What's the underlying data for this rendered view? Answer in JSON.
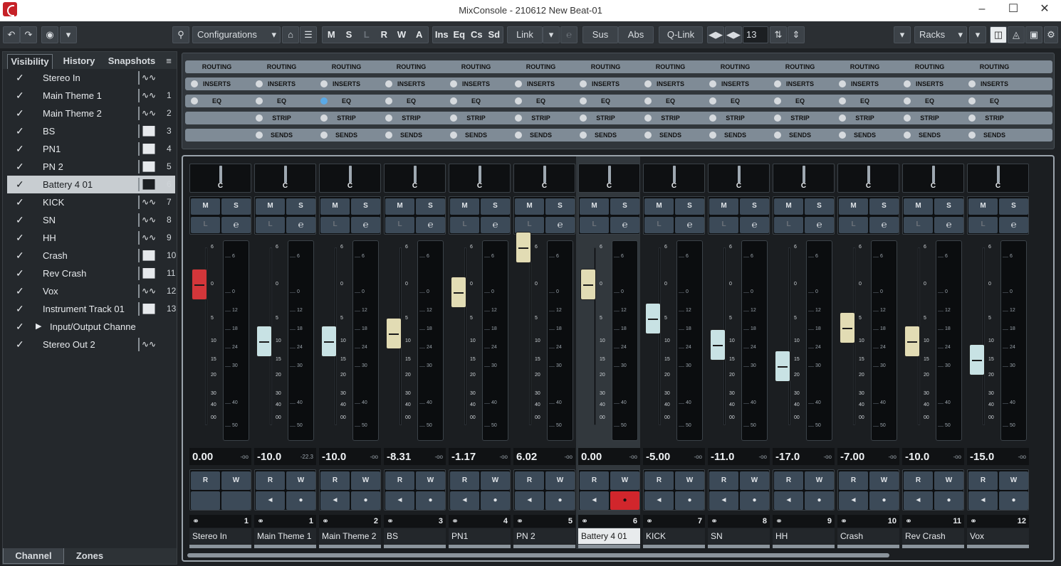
{
  "window": {
    "title": "MixConsole - 210612 New Beat-01"
  },
  "toolbar": {
    "configurations": "Configurations",
    "automation_modes": [
      "M",
      "S",
      "L",
      "R",
      "W",
      "A"
    ],
    "rack_toggles": [
      "Ins",
      "Eq",
      "Cs",
      "Sd"
    ],
    "link_label": "Link",
    "sus_label": "Sus",
    "abs_label": "Abs",
    "qlink_label": "Q-Link",
    "channel_count": "13",
    "racks_label": "Racks"
  },
  "left_panel": {
    "tabs": [
      "Visibility",
      "History",
      "Snapshots"
    ],
    "bottom_tabs": [
      "Channel",
      "Zones"
    ],
    "items": [
      {
        "name": "Stereo In",
        "icon": "waveform-icon",
        "num": ""
      },
      {
        "name": "Main Theme 1",
        "icon": "waveform-icon",
        "num": "1"
      },
      {
        "name": "Main Theme 2",
        "icon": "waveform-icon",
        "num": "2"
      },
      {
        "name": "BS",
        "icon": "piano-icon",
        "num": "3"
      },
      {
        "name": "PN1",
        "icon": "piano-icon",
        "num": "4"
      },
      {
        "name": "PN 2",
        "icon": "piano-icon",
        "num": "5"
      },
      {
        "name": "Battery 4 01",
        "icon": "piano-icon",
        "num": "6"
      },
      {
        "name": "KICK",
        "icon": "waveform-icon",
        "num": "7"
      },
      {
        "name": "SN",
        "icon": "waveform-icon",
        "num": "8"
      },
      {
        "name": "HH",
        "icon": "waveform-icon",
        "num": "9"
      },
      {
        "name": "Crash",
        "icon": "piano-icon",
        "num": "10"
      },
      {
        "name": "Rev Crash",
        "icon": "piano-icon",
        "num": "11"
      },
      {
        "name": "Vox",
        "icon": "waveform-icon",
        "num": "12"
      },
      {
        "name": "Instrument Track 01",
        "icon": "piano-icon",
        "num": "13"
      },
      {
        "name": "Input/Output Channe",
        "icon": "",
        "num": ""
      },
      {
        "name": "Stereo Out 2",
        "icon": "waveform-icon",
        "num": ""
      }
    ]
  },
  "rack_labels": {
    "routing": "ROUTING",
    "inserts": "INSERTS",
    "eq": "EQ",
    "strip": "STRIP",
    "sends": "SENDS"
  },
  "scale_labels": [
    "6",
    "0",
    "5",
    "10",
    "15",
    "20",
    "30",
    "40",
    "00"
  ],
  "meter_labels": [
    "6",
    "0",
    "12",
    "18",
    "24",
    "30",
    "40",
    "50"
  ],
  "channels": [
    {
      "name": "Stereo In",
      "num": "1",
      "volume": "0.00",
      "peak": "-oo",
      "pan": "C",
      "fader_db": 0,
      "fader_color": "#d3363a"
    },
    {
      "name": "Main Theme 1",
      "num": "1",
      "volume": "-10.0",
      "peak": "-22.3",
      "pan": "C",
      "fader_db": -10,
      "fader_color": "#c8e2e4"
    },
    {
      "name": "Main Theme 2",
      "num": "2",
      "volume": "-10.0",
      "peak": "-oo",
      "pan": "C",
      "fader_db": -10,
      "fader_color": "#c8e2e4"
    },
    {
      "name": "BS",
      "num": "3",
      "volume": "-8.31",
      "peak": "-oo",
      "pan": "C",
      "fader_db": -8.31,
      "fader_color": "#e2dcb4"
    },
    {
      "name": "PN1",
      "num": "4",
      "volume": "-1.17",
      "peak": "-oo",
      "pan": "C",
      "fader_db": -1.17,
      "fader_color": "#e2dcb4"
    },
    {
      "name": "PN 2",
      "num": "5",
      "volume": "6.02",
      "peak": "-oo",
      "pan": "C",
      "fader_db": 6.02,
      "fader_color": "#e2dcb4"
    },
    {
      "name": "Battery 4 01",
      "num": "6",
      "volume": "0.00",
      "peak": "-oo",
      "pan": "C",
      "fader_db": 0,
      "fader_color": "#e2dcb4",
      "selected": true,
      "record": true
    },
    {
      "name": "KICK",
      "num": "7",
      "volume": "-5.00",
      "peak": "-oo",
      "pan": "C",
      "fader_db": -5,
      "fader_color": "#c8e2e4"
    },
    {
      "name": "SN",
      "num": "8",
      "volume": "-11.0",
      "peak": "-oo",
      "pan": "C",
      "fader_db": -11,
      "fader_color": "#c8e2e4"
    },
    {
      "name": "HH",
      "num": "9",
      "volume": "-17.0",
      "peak": "-oo",
      "pan": "C",
      "fader_db": -17,
      "fader_color": "#c8e2e4"
    },
    {
      "name": "Crash",
      "num": "10",
      "volume": "-7.00",
      "peak": "-oo",
      "pan": "C",
      "fader_db": -7,
      "fader_color": "#e2dcb4"
    },
    {
      "name": "Rev Crash",
      "num": "11",
      "volume": "-10.0",
      "peak": "-oo",
      "pan": "C",
      "fader_db": -10,
      "fader_color": "#e2dcb4"
    },
    {
      "name": "Vox",
      "num": "12",
      "volume": "-15.0",
      "peak": "-oo",
      "pan": "C",
      "fader_db": -15,
      "fader_color": "#c8e2e4"
    }
  ]
}
